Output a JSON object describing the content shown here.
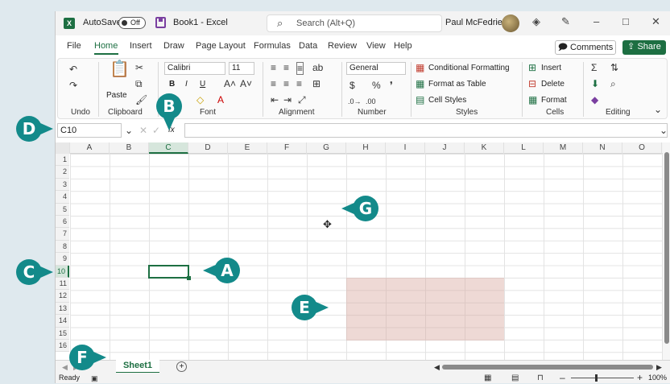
{
  "titlebar": {
    "app_icon": "excel-icon",
    "app_icon_text": "X",
    "autosave_label": "AutoSave",
    "autosave_state": "Off",
    "doc_title": "Book1 - Excel",
    "search_placeholder": "Search (Alt+Q)",
    "user_name": "Paul McFedries",
    "minimize": "–",
    "maximize": "□",
    "close": "✕"
  },
  "tabs": [
    "File",
    "Home",
    "Insert",
    "Draw",
    "Page Layout",
    "Formulas",
    "Data",
    "Review",
    "View",
    "Help"
  ],
  "header_buttons": {
    "comments": "Comments",
    "share": "Share"
  },
  "ribbon": {
    "groups": [
      "Undo",
      "Clipboard",
      "Font",
      "Alignment",
      "Number",
      "Styles",
      "Cells",
      "Editing"
    ],
    "paste_label": "Paste",
    "font_name": "Calibri",
    "font_size": "11",
    "number_format": "General",
    "styles_items": [
      "Conditional Formatting",
      "Format as Table",
      "Cell Styles"
    ],
    "cells_items": [
      "Insert",
      "Delete",
      "Format"
    ],
    "bold": "B",
    "italic": "I",
    "underline": "U"
  },
  "formula_bar": {
    "name_box": "C10",
    "fx": "fx",
    "value": ""
  },
  "columns": [
    "A",
    "B",
    "C",
    "D",
    "E",
    "F",
    "G",
    "H",
    "I",
    "J",
    "K",
    "L",
    "M",
    "N",
    "O"
  ],
  "selected_column": "C",
  "rows": [
    "1",
    "2",
    "3",
    "4",
    "5",
    "6",
    "7",
    "8",
    "9",
    "10",
    "11",
    "12",
    "13",
    "14",
    "15",
    "16"
  ],
  "selected_row": "10",
  "sheets": {
    "active": "Sheet1",
    "add": "+"
  },
  "status": {
    "mode": "Ready",
    "zoom": "100%"
  },
  "callouts": [
    "A",
    "B",
    "C",
    "D",
    "E",
    "F",
    "G"
  ],
  "colors": {
    "accent": "#1d6f42",
    "callout": "#138a8a",
    "highlight": "#d7a59b"
  }
}
